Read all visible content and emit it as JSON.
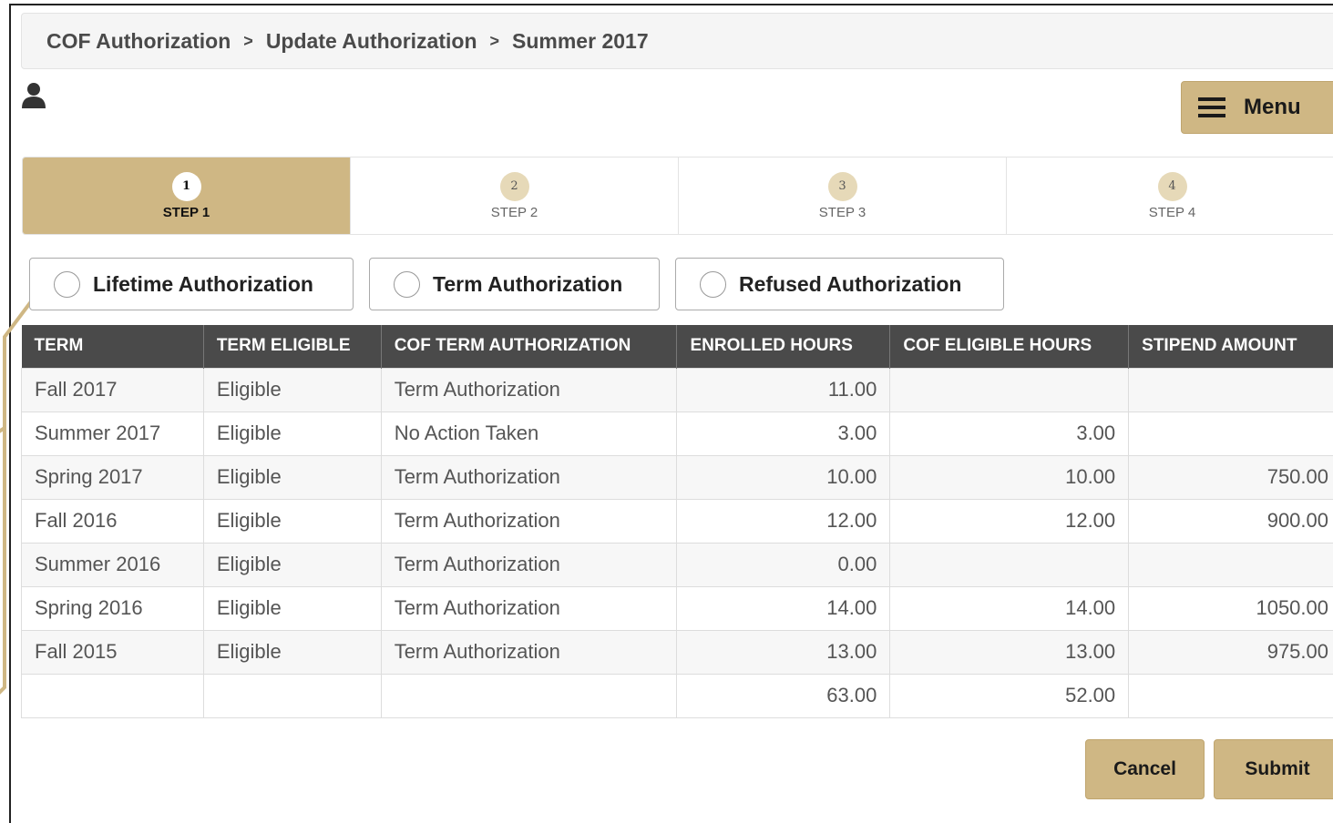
{
  "breadcrumb": [
    "COF Authorization",
    "Update Authorization",
    "Summer 2017"
  ],
  "breadcrumb_separator": ">",
  "menu": {
    "label": "Menu"
  },
  "steps": [
    {
      "num": "1",
      "label": "STEP 1",
      "active": true
    },
    {
      "num": "2",
      "label": "STEP 2",
      "active": false
    },
    {
      "num": "3",
      "label": "STEP 3",
      "active": false
    },
    {
      "num": "4",
      "label": "STEP 4",
      "active": false
    }
  ],
  "options": {
    "lifetime": "Lifetime Authorization",
    "term": "Term Authorization",
    "refused": "Refused Authorization"
  },
  "table": {
    "headers": [
      "TERM",
      "TERM ELIGIBLE",
      "COF TERM AUTHORIZATION",
      "ENROLLED HOURS",
      "COF ELIGIBLE HOURS",
      "STIPEND AMOUNT"
    ],
    "rows": [
      [
        "Fall 2017",
        "Eligible",
        "Term Authorization",
        "11.00",
        "",
        ""
      ],
      [
        "Summer 2017",
        "Eligible",
        "No Action Taken",
        "3.00",
        "3.00",
        ""
      ],
      [
        "Spring 2017",
        "Eligible",
        "Term Authorization",
        "10.00",
        "10.00",
        "750.00"
      ],
      [
        "Fall 2016",
        "Eligible",
        "Term Authorization",
        "12.00",
        "12.00",
        "900.00"
      ],
      [
        "Summer 2016",
        "Eligible",
        "Term Authorization",
        "0.00",
        "",
        ""
      ],
      [
        "Spring 2016",
        "Eligible",
        "Term Authorization",
        "14.00",
        "14.00",
        "1050.00"
      ],
      [
        "Fall 2015",
        "Eligible",
        "Term Authorization",
        "13.00",
        "13.00",
        "975.00"
      ],
      [
        "",
        "",
        "",
        "63.00",
        "52.00",
        ""
      ]
    ]
  },
  "buttons": {
    "cancel": "Cancel",
    "submit": "Submit"
  },
  "colors": {
    "accent": "#cfb784",
    "header_bg": "#4a4a4a"
  }
}
